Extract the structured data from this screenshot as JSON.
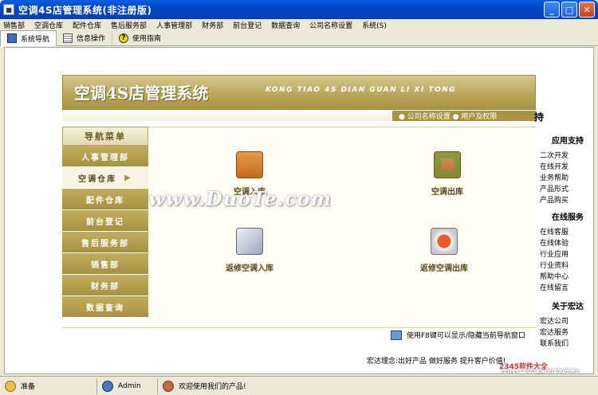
{
  "window": {
    "title": "空调4S店管理系统(非注册版)",
    "minimize": "_",
    "maximize": "□",
    "close": "✕"
  },
  "menu": [
    "销售部",
    "空调仓库",
    "配件仓库",
    "售后服务部",
    "人事管理部",
    "财务部",
    "前台登记",
    "数据查询",
    "公司名称设置",
    "系统(S)"
  ],
  "toolbar": [
    {
      "label": "系统导航",
      "icon": "monitor-icon"
    },
    {
      "label": "信息操作",
      "icon": "grid-icon"
    },
    {
      "label": "使用指南",
      "icon": "help-icon"
    }
  ],
  "banner": {
    "title": "空调4S店管理系统",
    "pinyin": "KONG TIAO  4S DIAN GUAN LI XI TONG"
  },
  "top_links": "● 公司名称设置  ● 用户及权限",
  "nav": {
    "header": "导航菜单",
    "items": [
      "人事管理部",
      "空调仓库",
      "配件仓库",
      "前台登记",
      "售后服务部",
      "销售部",
      "财务部",
      "数据查询"
    ],
    "selected_index": 1
  },
  "modules": [
    {
      "label": "空调入库",
      "icon": "inbound-box-icon",
      "color": "#d47a2a"
    },
    {
      "label": "空调出库",
      "icon": "outbound-box-icon",
      "color": "#6a9a3a"
    },
    {
      "label": "返修空调入库",
      "icon": "repair-in-icon",
      "color": "#7a8aa8"
    },
    {
      "label": "返修空调出库",
      "icon": "repair-out-icon",
      "color": "#c84a2a"
    }
  ],
  "footer_hint": "使用F8键可以显示/隐藏当前导航窗口",
  "slogan": "宏达理念:出好产品  做好服务  提升客户价值!",
  "right_panel": {
    "header_partial": "持",
    "sections": [
      {
        "title": "应用支持",
        "items": [
          "二次开发",
          "在线开发",
          "业务帮助",
          "产品形式",
          "产品购买"
        ]
      },
      {
        "title": "在线服务",
        "items": [
          "在线客服",
          "在线体验",
          "行业应用",
          "行业资料",
          "帮助中心",
          "在线留言"
        ]
      },
      {
        "title": "关于宏达",
        "items": [
          "宏达公司",
          "宏达服务",
          "联系我们"
        ]
      }
    ]
  },
  "watermark": {
    "main": "www.DuoTe.com",
    "sub1": "2345软件大全",
    "sub2": "国内最安全的软件站"
  },
  "status": [
    "准备",
    "Admin",
    "欢迎使用我们的产品!"
  ]
}
